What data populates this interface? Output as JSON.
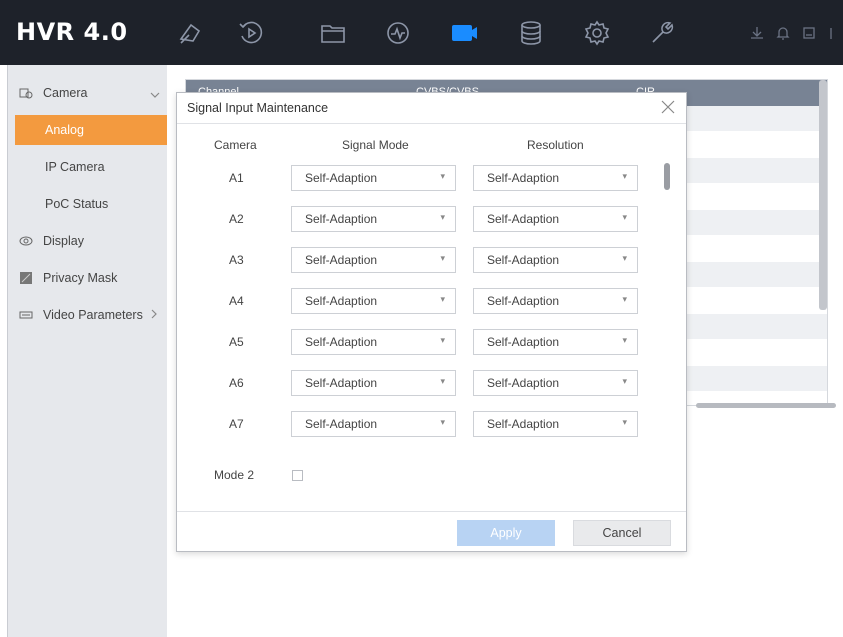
{
  "app": {
    "title": "HVR 4.0"
  },
  "topbar": {
    "icons": [
      "live-view-icon",
      "playback-icon",
      "file-icon",
      "smart-icon",
      "camera-icon",
      "storage-icon",
      "settings-icon",
      "maintenance-icon"
    ],
    "system_icons": [
      "download-icon",
      "bell-icon",
      "alarm-icon",
      "power-icon"
    ],
    "active_color": "#1a8cff"
  },
  "sidebar": {
    "items": [
      {
        "label": "Camera",
        "icon": "camera-icon"
      },
      {
        "label": "Analog"
      },
      {
        "label": "IP Camera"
      },
      {
        "label": "PoC Status"
      },
      {
        "label": "Display",
        "icon": "display-icon"
      },
      {
        "label": "Privacy Mask",
        "icon": "privacy-mask-icon"
      },
      {
        "label": "Video Parameters",
        "icon": "video-parameters-icon"
      }
    ],
    "active_color": "#f39a3f"
  },
  "background_table": {
    "columns": [
      "Channel",
      "CVBS/CVBS",
      "CIR"
    ]
  },
  "dialog": {
    "title": "Signal Input Maintenance",
    "headers": {
      "camera": "Camera",
      "signal_mode": "Signal Mode",
      "resolution": "Resolution"
    },
    "rows": [
      {
        "camera": "A1",
        "signal_mode": "Self-Adaption",
        "resolution": "Self-Adaption"
      },
      {
        "camera": "A2",
        "signal_mode": "Self-Adaption",
        "resolution": "Self-Adaption"
      },
      {
        "camera": "A3",
        "signal_mode": "Self-Adaption",
        "resolution": "Self-Adaption"
      },
      {
        "camera": "A4",
        "signal_mode": "Self-Adaption",
        "resolution": "Self-Adaption"
      },
      {
        "camera": "A5",
        "signal_mode": "Self-Adaption",
        "resolution": "Self-Adaption"
      },
      {
        "camera": "A6",
        "signal_mode": "Self-Adaption",
        "resolution": "Self-Adaption"
      },
      {
        "camera": "A7",
        "signal_mode": "Self-Adaption",
        "resolution": "Self-Adaption"
      }
    ],
    "mode2_label": "Mode 2",
    "mode2_checked": false,
    "apply_label": "Apply",
    "cancel_label": "Cancel"
  }
}
